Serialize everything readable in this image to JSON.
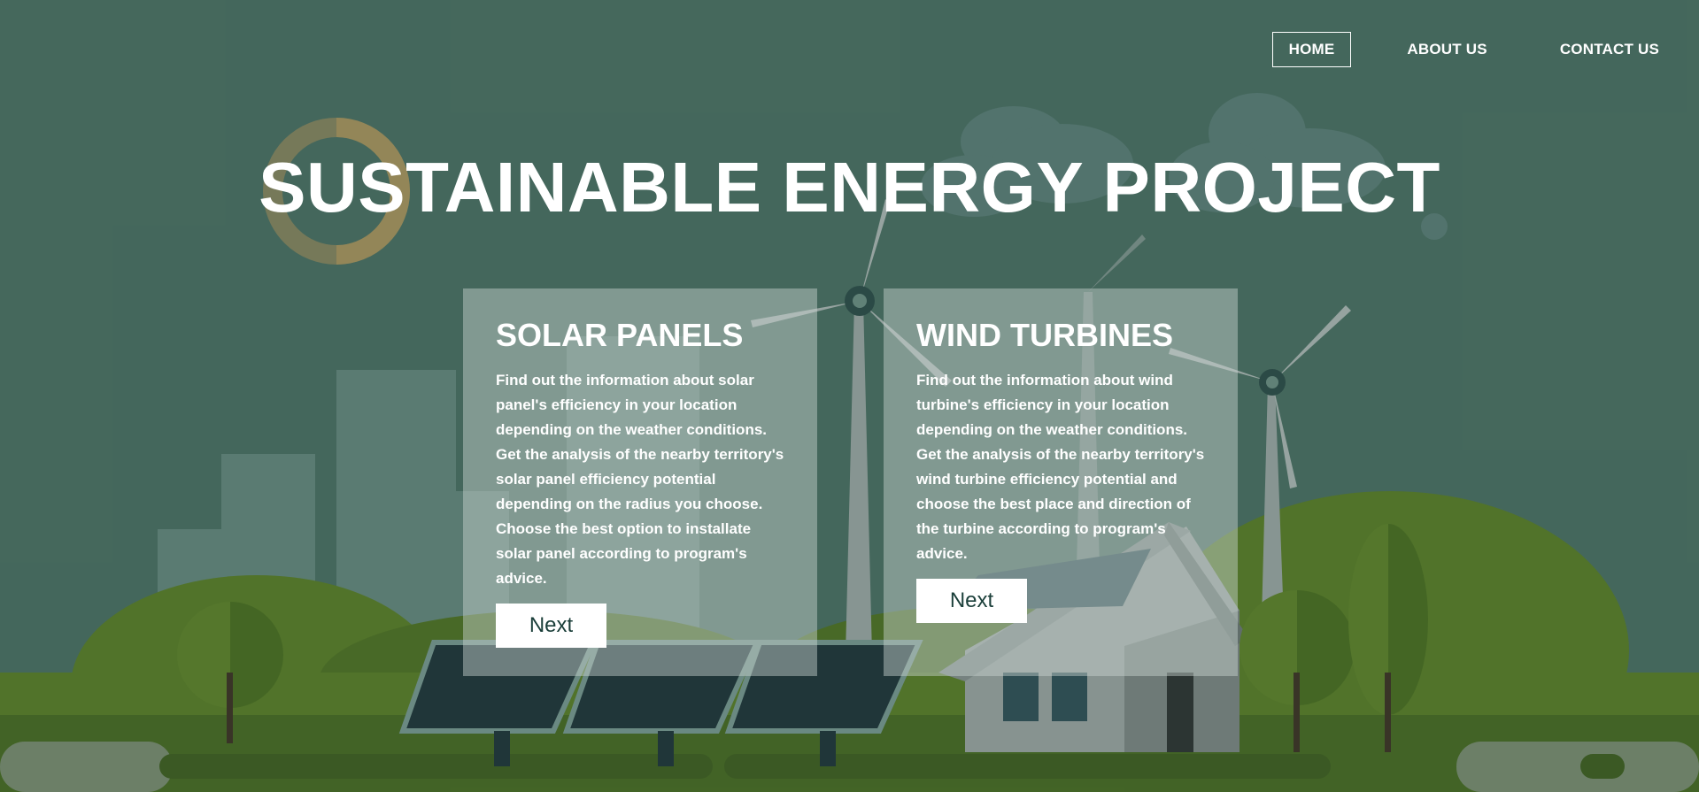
{
  "nav": {
    "items": [
      {
        "label": "HOME",
        "active": true
      },
      {
        "label": "ABOUT US",
        "active": false
      },
      {
        "label": "CONTACT US",
        "active": false
      }
    ]
  },
  "hero": {
    "title": "SUSTAINABLE ENERGY PROJECT"
  },
  "cards": [
    {
      "title": "SOLAR PANELS",
      "description": "Find out the information about solar panel's efficiency in your location depending on the weather conditions. Get the analysis of the nearby territory's solar panel efficiency potential depending on the radius you choose. Choose the best option to installate solar panel according to program's advice.",
      "button_label": "Next"
    },
    {
      "title": "WIND TURBINES",
      "description": "Find out the information about wind turbine's efficiency in your location depending on the weather conditions. Get the analysis of the nearby territory's wind turbine efficiency potential and choose the best place and direction of the turbine according to program's advice.",
      "button_label": "Next"
    }
  ],
  "colors": {
    "sky": "#4a6b5f",
    "hills": "#5a7a1f",
    "ground": "#47661a",
    "card_bg": "#cdd6d2",
    "button_text": "#1b3f3a"
  }
}
